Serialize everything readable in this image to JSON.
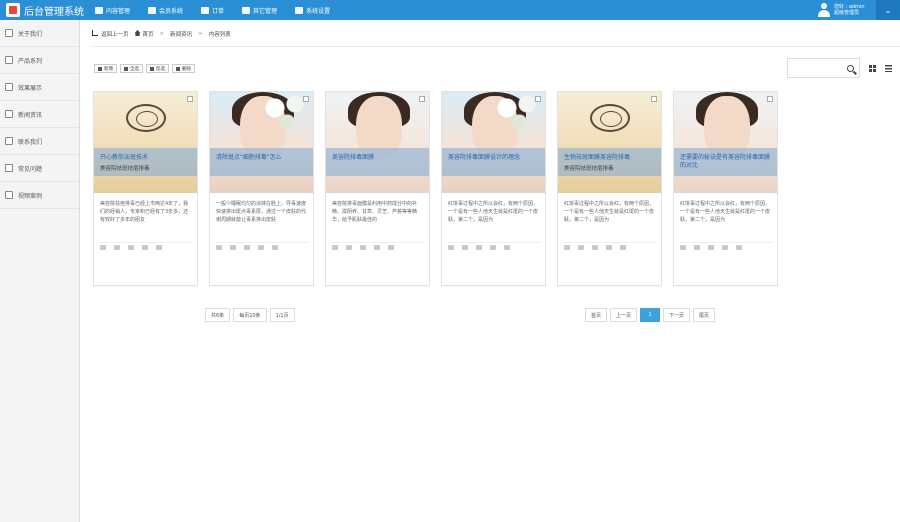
{
  "app": {
    "title": "后台管理系统"
  },
  "topnav": [
    {
      "label": "内容管理",
      "icon": "monitor-icon"
    },
    {
      "label": "会员系统",
      "icon": "user-icon"
    },
    {
      "label": "订单",
      "icon": "order-icon"
    },
    {
      "label": "其它管理",
      "icon": "puzzle-icon"
    },
    {
      "label": "系统设置",
      "icon": "gear-icon"
    }
  ],
  "user": {
    "greeting": "您好 : admin",
    "role": "超级管理员"
  },
  "sidebar": {
    "items": [
      {
        "label": "关于我们"
      },
      {
        "label": "产品系列"
      },
      {
        "label": "效果展示"
      },
      {
        "label": "新闻资讯"
      },
      {
        "label": "联系我们"
      },
      {
        "label": "常见问题"
      },
      {
        "label": "视频案例"
      }
    ]
  },
  "breadcrumb": {
    "back": "返回上一页",
    "home": "首页",
    "section": "新闻资讯",
    "current": "内容列表",
    "separator": ">"
  },
  "toolbar": {
    "add": "新增",
    "all": "全选",
    "invert": "反选",
    "delete": "删除"
  },
  "cards": [
    {
      "title": "开心教你淡斑技术",
      "subtitle": "美容院祛斑祛痘排毒",
      "desc": "美容院祛痘排毒已经上市两达4年了，我们的经销人，专家积已经有了3年多，还有较好了多年的朋友",
      "image": "logo"
    },
    {
      "title": "清除斑点\"细胞排毒\"怎么",
      "subtitle": "",
      "desc": "一般少睡眠均匀的涂抹在脸上，导毒速度快速排出斑点毒素层，通过一个皮肤的代谢周期就能让毒素排出皮肤",
      "image": "face-blue"
    },
    {
      "title": "美容院排毒面膜",
      "subtitle": "",
      "desc": "美容院排毒面膜是利用中药成分中的补精、滋阴养、甘草、灵芝、芦荟等等精华，给予肌肤最佳的",
      "image": "face"
    },
    {
      "title": "美容院排毒面膜设计的理念",
      "subtitle": "",
      "desc": "红饼毒过程中之所以会红，有两个原因，一个是有一些人他天生就是红斑的一个皮肤，第二个，是因为",
      "image": "face-blue"
    },
    {
      "title": "生物祛斑面膜美容院排毒",
      "subtitle": "美容院祛斑祛痘排毒",
      "desc": "红饼毒过程中之所以会红，有两个原因，一个是有一些人他天生就是红斑的一个皮肤，第二个，是因为",
      "image": "logo"
    },
    {
      "title": "还需要的秘诀是有美容院排毒面膜的对比",
      "subtitle": "",
      "desc": "红饼毒过程中之所以会红，有两个原因，一个是有一些人他天生就是红斑的一个皮肤，第二个，是因为",
      "image": "face"
    }
  ],
  "pageinfo": {
    "total": "共6条",
    "per_page": "每页10条",
    "pages": "1/1页"
  },
  "pager": {
    "first": "首页",
    "prev": "上一页",
    "current": "1",
    "next": "下一页",
    "last": "尾页"
  }
}
